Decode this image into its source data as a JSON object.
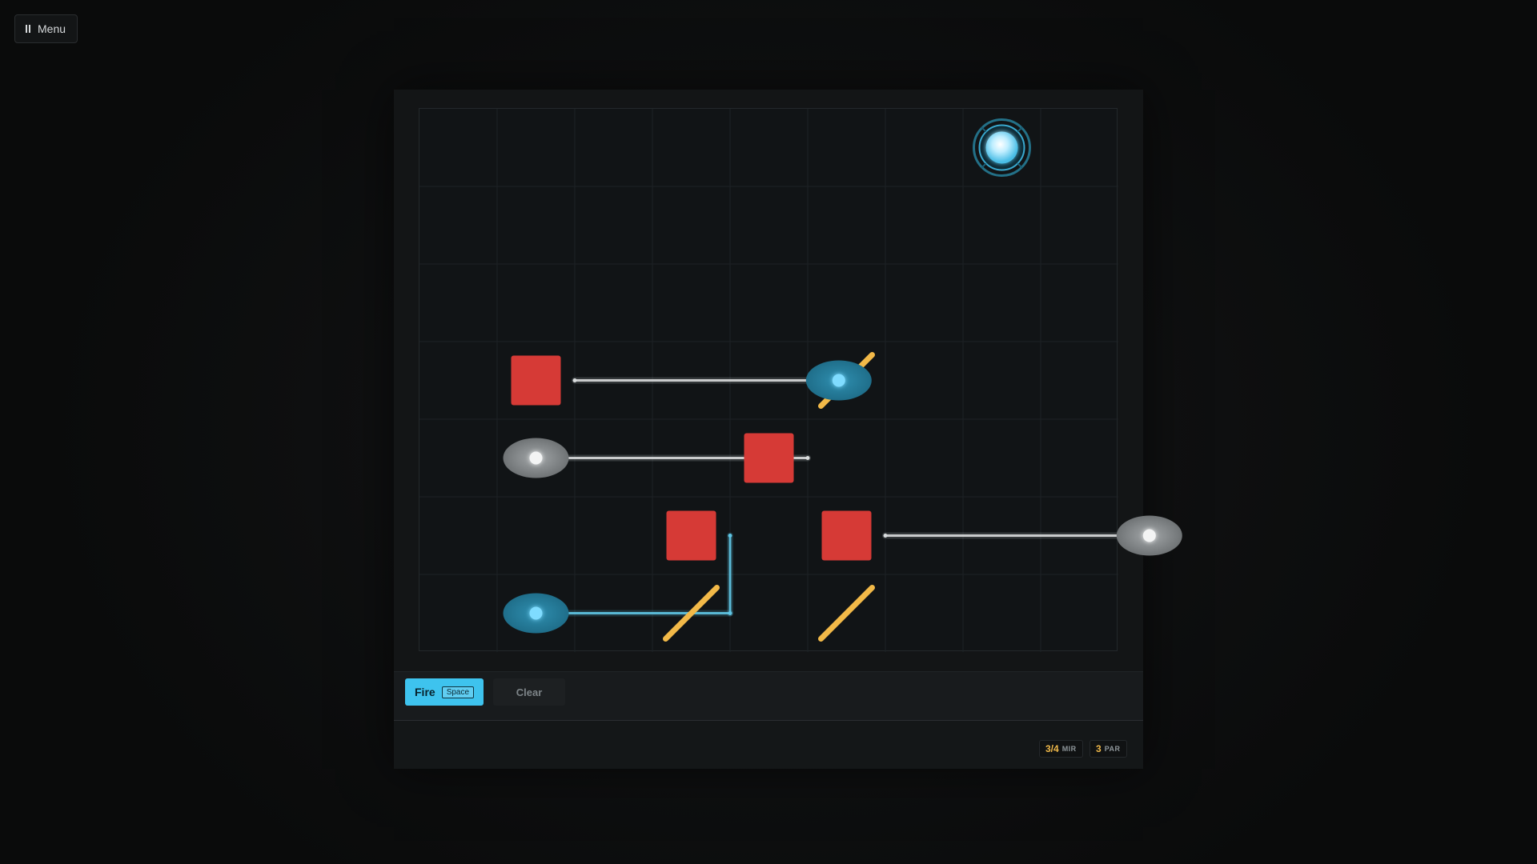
{
  "menu": {
    "label": "Menu",
    "icon": "pause-icon"
  },
  "toolbar": {
    "fire_label": "Fire",
    "fire_key": "Space",
    "clear_label": "Clear"
  },
  "stats": {
    "mirrors_value": "3/4",
    "mirrors_label": "MIR",
    "par_value": "3",
    "par_label": "PAR"
  },
  "board": {
    "columns": 9,
    "rows": 7,
    "colors": {
      "grid": "#1d2225",
      "block": "#d63a36",
      "mirror": "#f2b948",
      "beam_white": "#d9dcdd",
      "beam_blue": "#5fc6e6",
      "emitter_blue": "#1f6e8a",
      "emitter_gray": "#8a8e90",
      "target": "#7fd6f4"
    },
    "target": {
      "col": 7,
      "row": 0,
      "icon": "target-orb-icon"
    },
    "blocks": [
      {
        "col": 1,
        "row": 3
      },
      {
        "col": 4,
        "row": 4
      },
      {
        "col": 3,
        "row": 5
      },
      {
        "col": 5,
        "row": 5
      }
    ],
    "mirrors": [
      {
        "col": 5,
        "row": 3,
        "orientation": "/"
      },
      {
        "col": 3,
        "row": 6,
        "orientation": "/"
      },
      {
        "col": 5,
        "row": 6,
        "orientation": "/"
      }
    ],
    "emitters": [
      {
        "col": 4.9,
        "row": 3,
        "type": "active"
      },
      {
        "col": 1,
        "row": 4,
        "type": "inactive"
      },
      {
        "col": 8.9,
        "row": 5,
        "type": "inactive"
      },
      {
        "col": 1,
        "row": 6,
        "type": "active"
      }
    ],
    "beams": [
      {
        "from": [
          4.9,
          3
        ],
        "to": [
          1.5,
          3
        ],
        "color": "white"
      },
      {
        "from": [
          1,
          4
        ],
        "to": [
          4.5,
          4
        ],
        "color": "white"
      },
      {
        "from": [
          8.9,
          5
        ],
        "to": [
          5.5,
          5
        ],
        "color": "white"
      },
      {
        "from": [
          1,
          6
        ],
        "to": [
          3.5,
          6
        ],
        "color": "blue"
      },
      {
        "from": [
          3.5,
          6
        ],
        "to": [
          3.5,
          5
        ],
        "color": "blue"
      }
    ]
  }
}
